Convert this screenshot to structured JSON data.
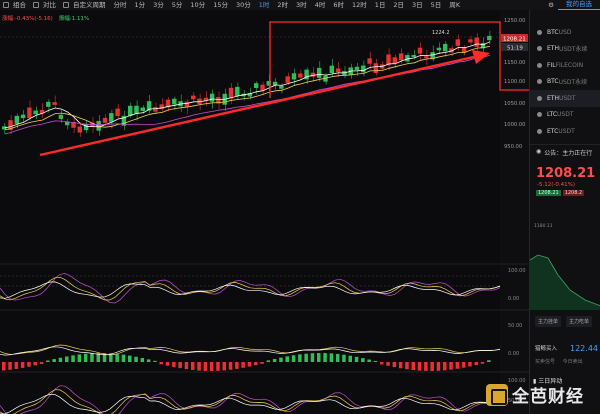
{
  "toolbar": {
    "items": [
      "组合",
      "对比",
      "自定义周期"
    ],
    "periods": [
      "分时",
      "1分",
      "3分",
      "5分",
      "10分",
      "15分",
      "30分",
      "1时",
      "2时",
      "3时",
      "4时",
      "6时",
      "12时",
      "1日",
      "2日",
      "3日",
      "5日",
      "周K"
    ],
    "active_period": "1时",
    "right_tab": "我的自选"
  },
  "legend": {
    "change_label": "涨幅:-0.43%(-5.16)",
    "amplitude_label": "振幅:1.11%"
  },
  "chart": {
    "price_labels": [
      "1250.00",
      "1150.00",
      "1100.00",
      "1050.00",
      "1000.00",
      "950.00"
    ],
    "current_price_tag": "1208.21",
    "countdown_tag": "51:19",
    "high_annotation": "1224.2",
    "rsi_labels": [
      "100.00",
      "50.00",
      "0.00"
    ],
    "macd_labels": [
      "50.00",
      "0.00"
    ],
    "kdj_labels": [
      "100.00",
      "50.00"
    ],
    "colors": {
      "up": "#2fbf5a",
      "down": "#e8322e",
      "arrow": "#ff2a2a",
      "box": "#ff2a2a"
    }
  },
  "watchlist": [
    {
      "symbol": "BTC",
      "quote": "USD"
    },
    {
      "symbol": "ETH",
      "quote": "USDT永续"
    },
    {
      "symbol": "FIL",
      "quote": "FILECOIN"
    },
    {
      "symbol": "BTC",
      "quote": "USDT永续"
    },
    {
      "symbol": "ETH",
      "quote": "USDT"
    },
    {
      "symbol": "LTC",
      "quote": "USDT"
    },
    {
      "symbol": "ETC",
      "quote": "USDT"
    }
  ],
  "panel": {
    "notice": "公告：主力正在行",
    "price": "1208.21",
    "change": "-5.12(-0.41%)",
    "pill_high": "1208.21",
    "pill_low": "1208.2",
    "mini_label": "1180.11",
    "buttons": [
      "主力挂单",
      "主力吃单"
    ],
    "buy_label": "猎鲸买入",
    "buy_value": "122.44",
    "buy_sub": "买卖信号",
    "buy_sub2": "今日卖出",
    "alert": "三日异动"
  },
  "watermark": {
    "text": "全芭财经"
  }
}
